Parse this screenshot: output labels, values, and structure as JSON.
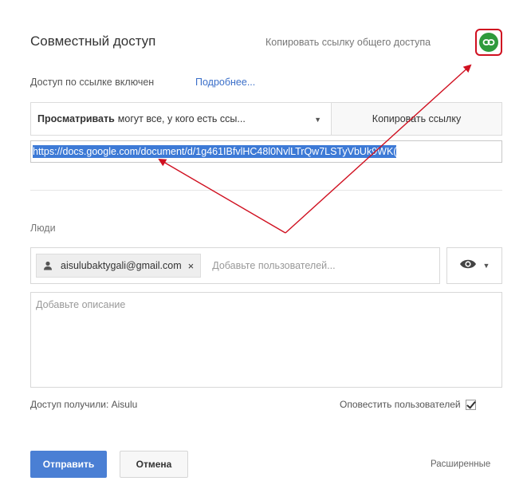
{
  "dialog": {
    "title": "Совместный доступ",
    "copy_public_link_label": "Копировать ссылку общего доступа",
    "access_status": "Доступ по ссылке включен",
    "more_link": "Подробнее...",
    "access_select": {
      "bold": "Просматривать",
      "rest": "могут все, у кого есть ссы..."
    },
    "copy_link_button": "Копировать ссылку",
    "url": "https://docs.google.com/document/d/1g461IBfvlHC48l0NvlLTrQw7LSTyVbUk9WK(",
    "people_label": "Люди",
    "chip_email": "aisulubaktygali@gmail.com",
    "chip_remove": "×",
    "add_users_placeholder": "Добавьте пользователей...",
    "description_placeholder": "Добавьте описание",
    "access_received": "Доступ получили: Aisulu",
    "notify_label": "Оповестить пользователей",
    "send_button": "Отправить",
    "cancel_button": "Отмена",
    "advanced_link": "Расширенные"
  },
  "colors": {
    "link_icon_bg": "#2e9a3c",
    "annotation_red": "#d01020",
    "primary_button": "#4a7fd4",
    "link_blue": "#3b6fc9",
    "selection_blue": "#3d7ad6"
  }
}
